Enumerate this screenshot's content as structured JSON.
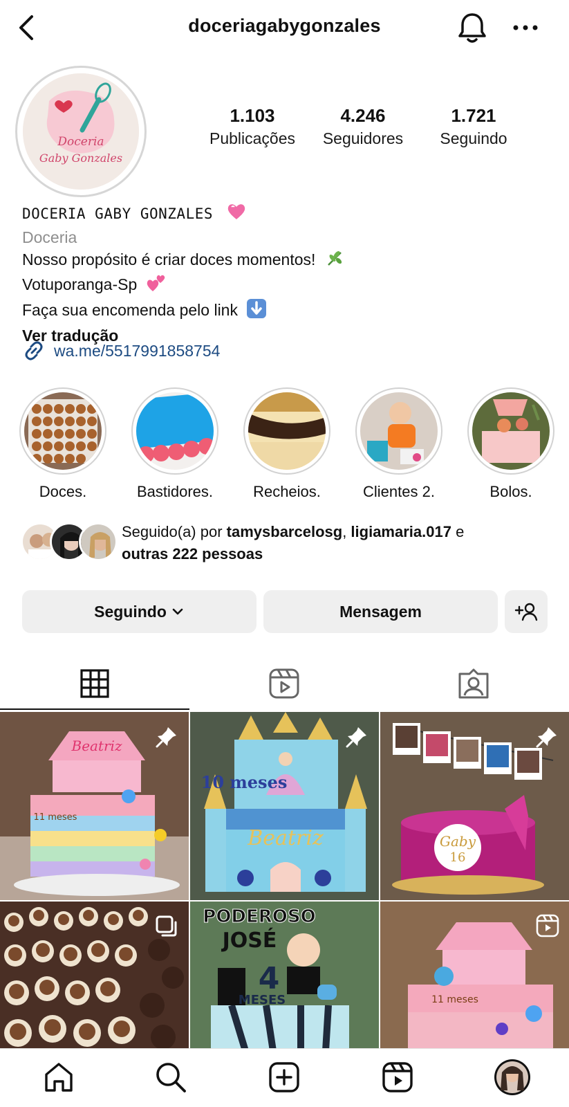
{
  "header": {
    "username": "doceriagabygonzales"
  },
  "profile": {
    "avatar_text_line1": "Doceria",
    "avatar_text_line2": "Gaby Gonzales",
    "stats": [
      {
        "value": "1.103",
        "label": "Publicações"
      },
      {
        "value": "4.246",
        "label": "Seguidores"
      },
      {
        "value": "1.721",
        "label": "Seguindo"
      }
    ]
  },
  "bio": {
    "name": "DOCERIA GABY GONZALES",
    "category": "Doceria",
    "line1": "Nosso propósito é criar doces momentos!",
    "line2": "Votuporanga-Sp",
    "line3": "Faça sua encomenda pelo link",
    "translate": "Ver tradução",
    "link": "wa.me/5517991858754"
  },
  "highlights": [
    {
      "label": "Doces."
    },
    {
      "label": "Bastidores."
    },
    {
      "label": "Recheios."
    },
    {
      "label": "Clientes 2."
    },
    {
      "label": "Bolos."
    }
  ],
  "followed_by": {
    "prefix": "Seguido(a) por ",
    "user1": "tamysbarcelosg",
    "sep": ", ",
    "user2": "ligiamaria.017",
    "and": " e",
    "others": "outras 222 pessoas"
  },
  "buttons": {
    "following": "Seguindo",
    "message": "Mensagem"
  },
  "grid_captions": {
    "post1_topper": "Beatriz",
    "post1_age": "11 meses",
    "post2_age": "10 meses",
    "post2_name": "Beatriz",
    "post3_name": "Gaby",
    "post3_age": "16",
    "post5_line1": "PODEROSO",
    "post5_line2": "JOSÉ",
    "post5_line3": "4",
    "post5_line4": "MESES",
    "post6_age": "11 meses"
  },
  "colors": {
    "text": "#111111",
    "muted": "#8e8e8e",
    "link": "#1d4b82",
    "button_bg": "#efefef"
  },
  "icons": [
    "back-icon",
    "bell-icon",
    "more-icon",
    "link-icon",
    "chevron-down-icon",
    "add-person-icon",
    "grid-icon",
    "reels-icon",
    "tagged-icon",
    "pin-icon",
    "carousel-icon",
    "home-icon",
    "search-icon",
    "create-icon",
    "reels-nav-icon",
    "profile-avatar"
  ]
}
